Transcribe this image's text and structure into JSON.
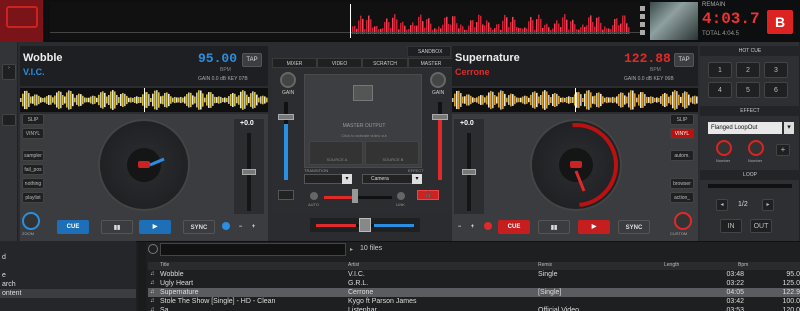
{
  "top": {
    "remain_label": "REMAIN",
    "remain_time": "4:03.7",
    "total_label": "TOTAL 4:04.5",
    "badge": "B"
  },
  "deck_left": {
    "title": "Wobble",
    "artist": "V.I.C.",
    "bpm": "95.00",
    "bpm_label": "BPM",
    "tap": "TAP",
    "meta": "GAIN 0.0 dB  KEY 07B",
    "pitch_value": "+0.0",
    "cue": "CUE",
    "pause": "▮▮",
    "play": "▶",
    "sync": "SYNC",
    "minus": "−",
    "plus": "+",
    "side_buttons": [
      "SLIP",
      "VINYL",
      "sampler",
      "fail_pos",
      "nothing",
      "playlist"
    ],
    "zoom": "ZOOM"
  },
  "deck_right": {
    "title": "Supernature",
    "artist": "Cerrone",
    "bpm": "122.88",
    "bpm_label": "BPM",
    "tap": "TAP",
    "meta": "GAIN 0.0 dB  KEY 06B",
    "pitch_value": "+0.0",
    "cue": "CUE",
    "pause": "▮▮",
    "play": "▶",
    "sync": "SYNC",
    "minus": "−",
    "plus": "+",
    "side_buttons": [
      "SLIP",
      "VINYL",
      "autom.",
      "browser",
      "action_"
    ],
    "custom": "CUSTOM"
  },
  "mixer": {
    "sandbox": "SANDBOX",
    "tabs": [
      "MIXER",
      "VIDEO",
      "SCRATCH",
      "MASTER"
    ],
    "gain": "GAIN",
    "master_output": "MASTER OUTPUT",
    "master_hint": "Click to activate video out",
    "source_a": "SOURCE A",
    "source_b": "SOURCE B",
    "transition": "TRANSITION",
    "effect": "EFFECT",
    "camera": "Camera",
    "auto": "AUTO",
    "link": "LINK",
    "headphones": "🎧"
  },
  "right_panel": {
    "hot_cue": "HOT CUE",
    "hotcues": [
      "1",
      "2",
      "3",
      "4",
      "5",
      "6"
    ],
    "effect_title": "EFFECT",
    "effect_name": "Flanged LoopOut",
    "knob1": "Number",
    "knob2": "Number",
    "loop_title": "LOOP",
    "loop_value": "1/2",
    "loop_in": "IN",
    "loop_out": "OUT"
  },
  "browser": {
    "folders": [
      "d",
      "",
      "e",
      "arch",
      "ontent"
    ],
    "file_count": "10 files",
    "columns": [
      "Title",
      "Artist",
      "Remix",
      "Length",
      "Bpm"
    ],
    "rows": [
      {
        "title": "Wobble",
        "artist": "V.I.C.",
        "remix": "Single",
        "length": "03:48",
        "bpm": "95.0"
      },
      {
        "title": "Ugly Heart",
        "artist": "G.R.L.",
        "remix": "",
        "length": "03:22",
        "bpm": "125.0"
      },
      {
        "title": "Supernature",
        "artist": "Cerrone",
        "remix": "[Single]",
        "length": "04:05",
        "bpm": "122.9"
      },
      {
        "title": "Stole The Show [Single] - HD - Clean",
        "artist": "Kygo ft Parson James",
        "remix": "",
        "length": "03:42",
        "bpm": "100.0"
      },
      {
        "title": "Sa",
        "artist": "Listenhar",
        "remix": "Official Video",
        "length": "03:53",
        "bpm": "120.0"
      }
    ]
  },
  "colors": {
    "left_accent": "#2a8fe0",
    "right_accent": "#e02a2a",
    "left_wave": "#d8c030",
    "right_wave": "#e0a020"
  }
}
